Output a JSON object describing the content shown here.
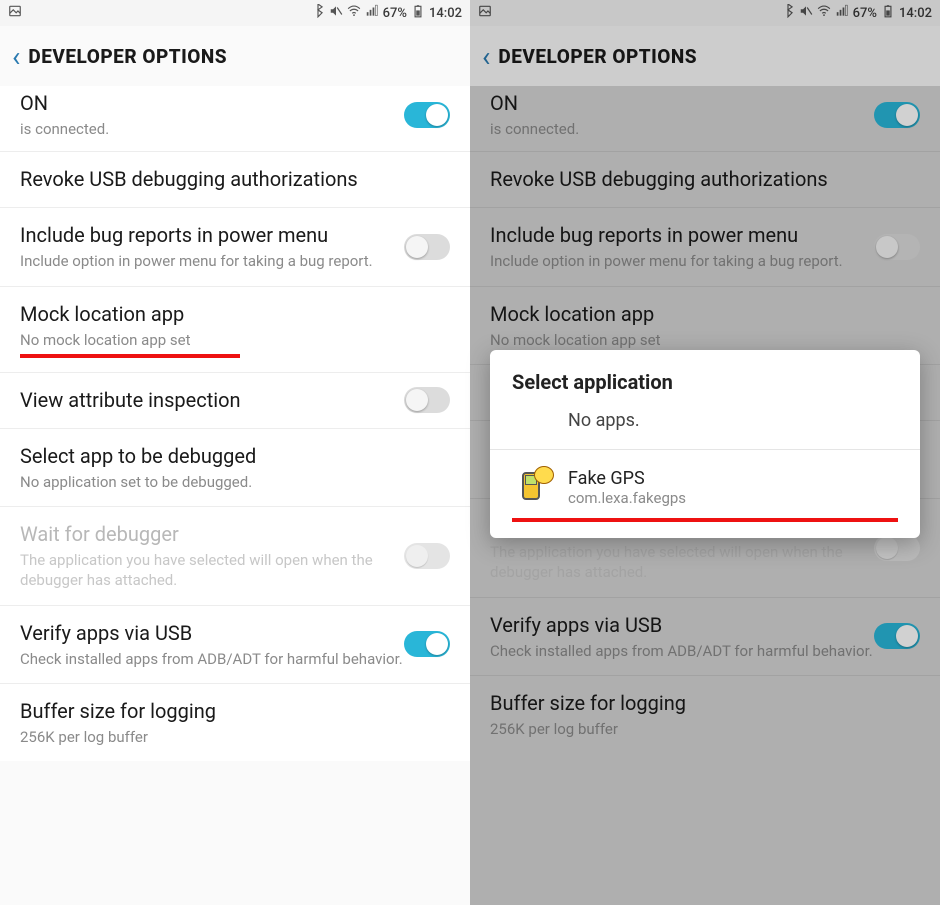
{
  "status": {
    "battery_pct": "67%",
    "time": "14:02"
  },
  "header": {
    "title": "DEVELOPER OPTIONS"
  },
  "top": {
    "on_label": "ON",
    "connected_sub": "is connected."
  },
  "items": {
    "revoke": {
      "title": "Revoke USB debugging authorizations"
    },
    "bugreport": {
      "title": "Include bug reports in power menu",
      "sub": "Include option in power menu for taking a bug report."
    },
    "mock": {
      "title": "Mock location app",
      "sub": "No mock location app set"
    },
    "viewattr": {
      "title": "View attribute inspection"
    },
    "debugapp": {
      "title": "Select app to be debugged",
      "sub": "No application set to be debugged."
    },
    "waitdbg": {
      "title": "Wait for debugger",
      "sub": "The application you have selected will open when the debugger has attached."
    },
    "verifyusb": {
      "title": "Verify apps via USB",
      "sub": "Check installed apps from ADB/ADT for harmful behavior."
    },
    "bufsize": {
      "title": "Buffer size for logging",
      "sub": "256K per log buffer"
    }
  },
  "dialog": {
    "title": "Select application",
    "noapps": "No apps.",
    "item": {
      "name": "Fake GPS",
      "package": "com.lexa.fakegps"
    }
  },
  "annotation_color": "#e11"
}
